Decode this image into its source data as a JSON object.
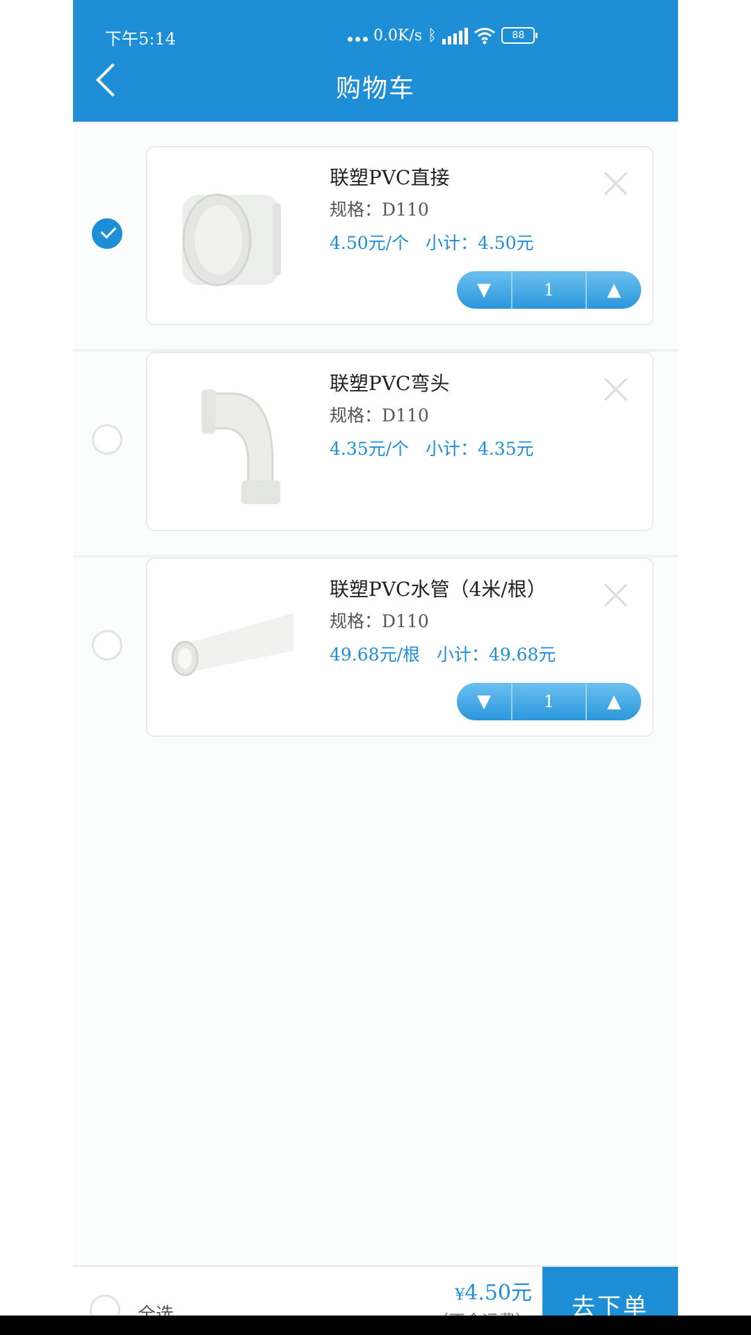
{
  "status": {
    "time": "下午5:14",
    "net_speed": "0.0K/s",
    "battery": "88"
  },
  "header": {
    "title": "购物车"
  },
  "items": [
    {
      "name": "联塑PVC直接",
      "spec": "规格：D110",
      "unit_price": "4.50元/个",
      "subtotal": "小计：4.50元",
      "checked": true,
      "quantity": "1",
      "show_stepper": true
    },
    {
      "name": "联塑PVC弯头",
      "spec": "规格：D110",
      "unit_price": "4.35元/个",
      "subtotal": "小计：4.35元",
      "checked": false,
      "quantity": "",
      "show_stepper": false
    },
    {
      "name": "联塑PVC水管（4米/根）",
      "spec": "规格：D110",
      "unit_price": "49.68元/根",
      "subtotal": "小计：49.68元",
      "checked": false,
      "quantity": "1",
      "show_stepper": true
    }
  ],
  "stepper": {
    "decrease": "▼",
    "increase": "▲"
  },
  "footer": {
    "select_all": "全选",
    "currency": "¥",
    "total": "4.50元",
    "note": "（不含运费）",
    "checkout": "去下单"
  },
  "colors": {
    "primary": "#1e8fd6"
  }
}
